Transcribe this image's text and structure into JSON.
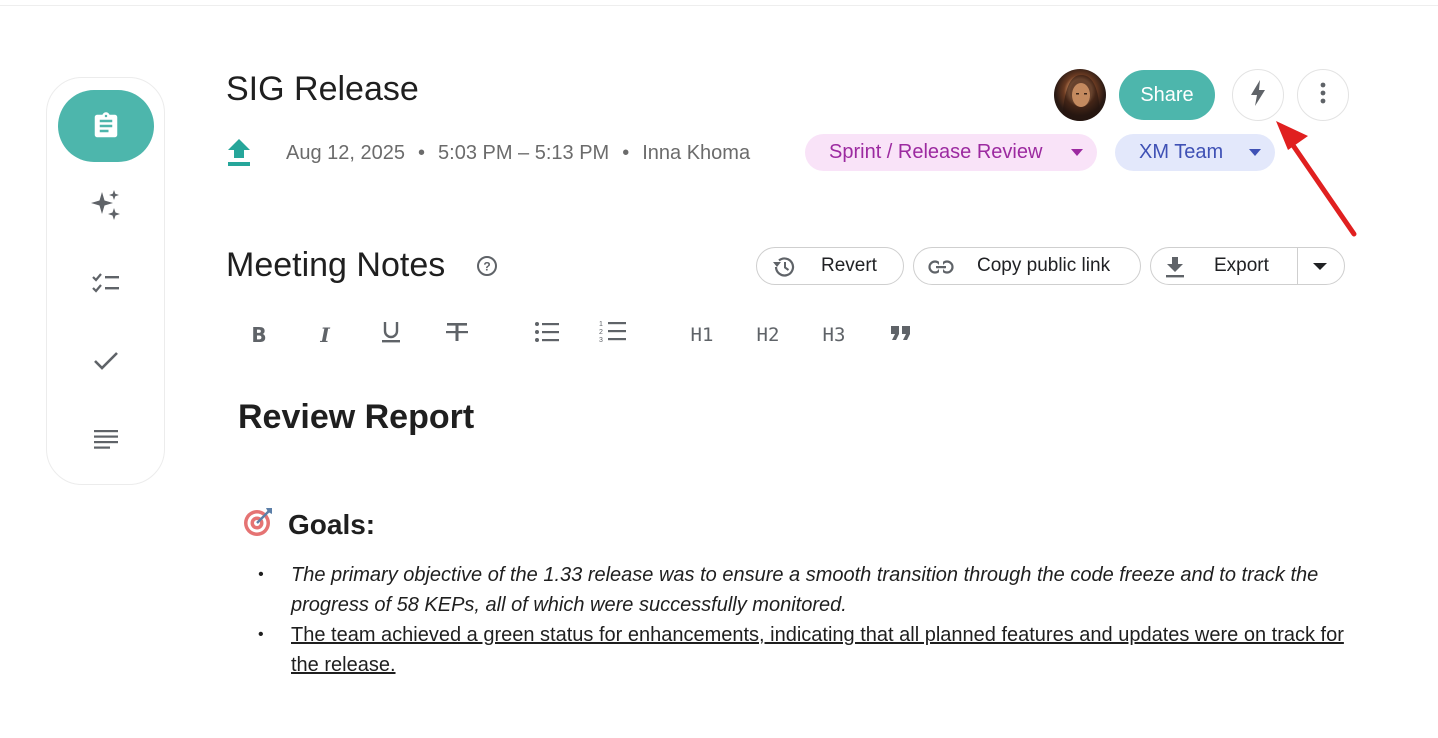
{
  "header": {
    "title": "SIG Release",
    "date": "Aug 12, 2025",
    "time_range": "5:03 PM – 5:13 PM",
    "author": "Inna Khoma",
    "separator": "•",
    "tags": [
      {
        "label": "Sprint / Release Review",
        "color": "#9c2aa0",
        "bg": "#f9e3f8"
      },
      {
        "label": "XM Team",
        "color": "#3f51b5",
        "bg": "#e3e8fb"
      }
    ],
    "share_label": "Share"
  },
  "sidebar": {
    "items": [
      {
        "icon": "clipboard-icon",
        "active": true
      },
      {
        "icon": "sparkles-icon"
      },
      {
        "icon": "checklist-icon"
      },
      {
        "icon": "check-icon"
      },
      {
        "icon": "lines-icon"
      }
    ]
  },
  "notes": {
    "title": "Meeting Notes",
    "revert_label": "Revert",
    "copy_link_label": "Copy public link",
    "export_label": "Export"
  },
  "toolbar": {
    "bold": "B",
    "italic": "I",
    "h1": "H1",
    "h2": "H2",
    "h3": "H3",
    "quote": "”"
  },
  "content": {
    "heading": "Review Report",
    "goals_label": "Goals:",
    "bullets": [
      "The primary objective of the 1.33 release was to ensure a smooth transition through the code freeze and to track the progress of 58 KEPs, all of which were successfully monitored.",
      "The team achieved a green status for enhancements, indicating that all planned features and updates were on track for the release."
    ]
  },
  "colors": {
    "accent": "#4db6ac",
    "annotation_arrow": "#e02020"
  }
}
